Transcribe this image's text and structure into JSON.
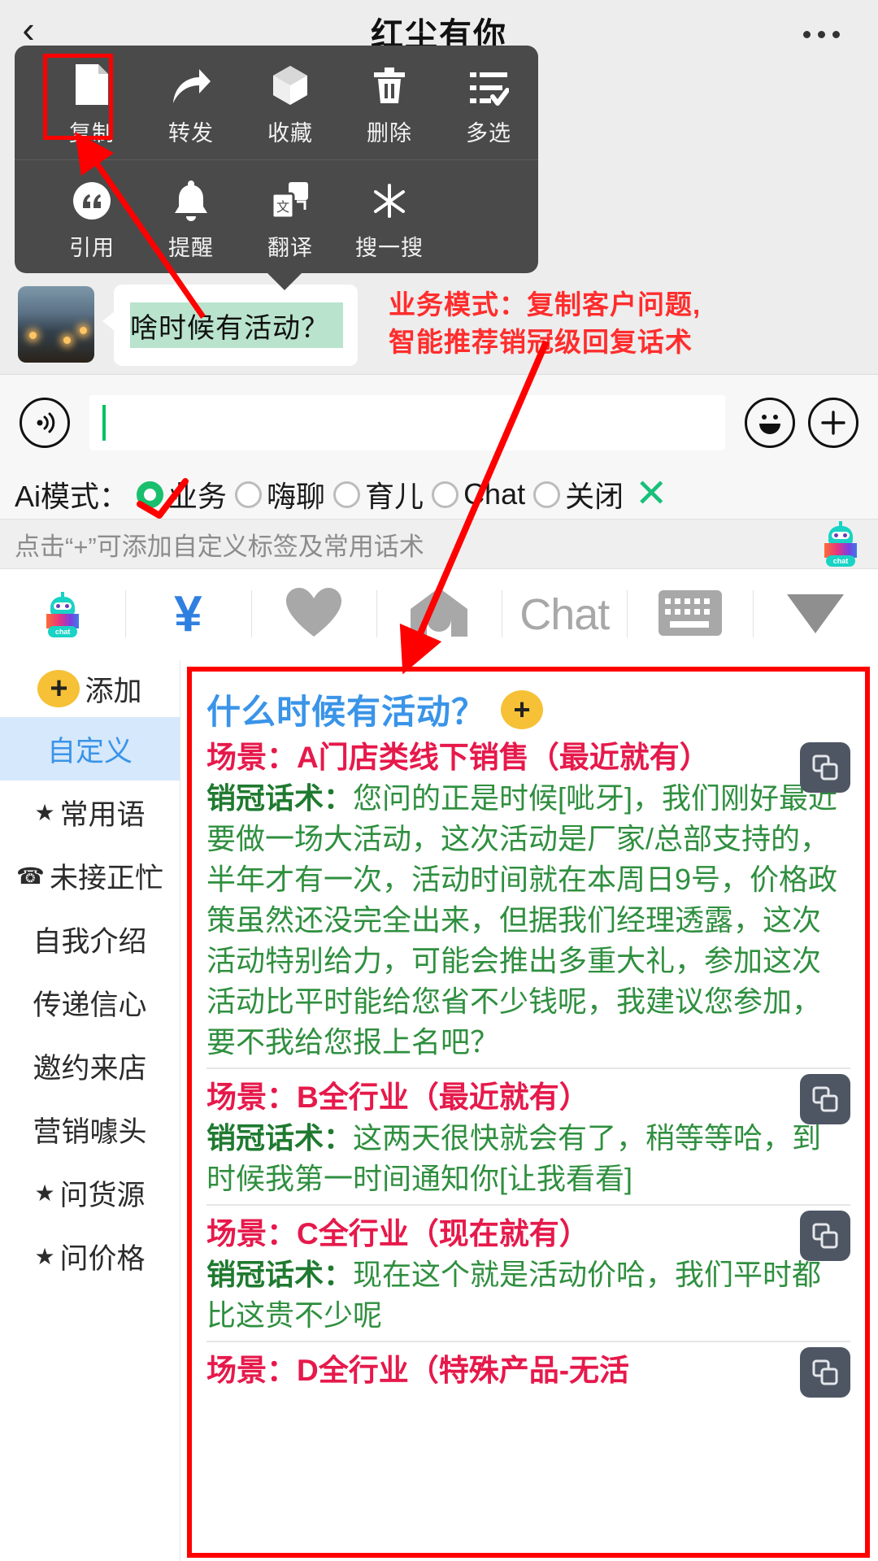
{
  "titlebar": {
    "back_icon": "chevron-left-icon",
    "title": "红尘有你",
    "more_icon": "more-dots-icon"
  },
  "context_menu": {
    "row1": [
      {
        "label": "复制",
        "icon": "copy-document-icon",
        "highlighted": true
      },
      {
        "label": "转发",
        "icon": "forward-arrow-icon",
        "highlighted": false
      },
      {
        "label": "收藏",
        "icon": "favorite-box-icon",
        "highlighted": false
      },
      {
        "label": "删除",
        "icon": "trash-icon",
        "highlighted": false
      },
      {
        "label": "多选",
        "icon": "multi-select-icon",
        "highlighted": false
      }
    ],
    "row2": [
      {
        "label": "引用",
        "icon": "quote-icon"
      },
      {
        "label": "提醒",
        "icon": "bell-icon"
      },
      {
        "label": "翻译",
        "icon": "translate-icon"
      },
      {
        "label": "搜一搜",
        "icon": "search-asterisk-icon"
      }
    ]
  },
  "message": {
    "avatar_name": "contact-avatar",
    "text": "啥时候有活动？"
  },
  "annotation": {
    "line1": "业务模式：复制客户问题,",
    "line2": "智能推荐销冠级回复话术",
    "color": "#ff2d2d"
  },
  "input_bar": {
    "voice_icon": "voice-wave-icon",
    "input_value": "",
    "input_placeholder": "",
    "emoji_icon": "smiley-icon",
    "plus_icon": "plus-circle-icon"
  },
  "ai_mode": {
    "label": "Ai模式：",
    "options": [
      {
        "label": "业务",
        "selected": true
      },
      {
        "label": "嗨聊",
        "selected": false
      },
      {
        "label": "育儿",
        "selected": false
      },
      {
        "label": "Chat",
        "selected": false
      },
      {
        "label": "关闭",
        "selected": false
      }
    ],
    "close_icon": "close-x-icon",
    "selected_color": "#1abf6d",
    "close_color": "#18c07a"
  },
  "hint": {
    "text": "点击“+”可添加自定义标签及常用话术",
    "robot_icon": "ai-chat-robot-icon",
    "robot_label": "chat"
  },
  "icon_toolbar": [
    {
      "icon": "ai-chat-robot-icon",
      "label": "chat"
    },
    {
      "icon": "yen-currency-icon",
      "label": "¥"
    },
    {
      "icon": "heart-icon",
      "label": ""
    },
    {
      "icon": "graduation-cap-icon",
      "label": ""
    },
    {
      "icon": "chat-text-icon",
      "label": "Chat"
    },
    {
      "icon": "keyboard-icon",
      "label": ""
    },
    {
      "icon": "chevron-down-triangle-icon",
      "label": ""
    }
  ],
  "sidebar": {
    "add_label": "添加",
    "add_icon": "plus-circle-yellow-icon",
    "items": [
      {
        "label": "自定义",
        "active": true,
        "star": false,
        "phone": false
      },
      {
        "label": "常用语",
        "active": false,
        "star": true,
        "phone": false
      },
      {
        "label": "未接正忙",
        "active": false,
        "star": false,
        "phone": true
      },
      {
        "label": "自我介绍",
        "active": false,
        "star": false,
        "phone": false
      },
      {
        "label": "传递信心",
        "active": false,
        "star": false,
        "phone": false
      },
      {
        "label": "邀约来店",
        "active": false,
        "star": false,
        "phone": false
      },
      {
        "label": "营销噱头",
        "active": false,
        "star": false,
        "phone": false
      },
      {
        "label": "问货源",
        "active": false,
        "star": true,
        "phone": false
      },
      {
        "label": "问价格",
        "active": false,
        "star": true,
        "phone": false
      }
    ]
  },
  "answer_panel": {
    "question": "什么时候有活动？",
    "add_icon": "plus-circle-yellow-icon",
    "copy_icon": "copy-squares-icon",
    "answer_prefix": "销冠话术：",
    "scenes": [
      {
        "title": "场景：A门店类线下销售（最近就有）",
        "answer": "您问的正是时候[呲牙]，我们刚好最近要做一场大活动，这次活动是厂家/总部支持的，半年才有一次，活动时间就在本周日9号，价格政策虽然还没完全出来，但据我们经理透露，这次活动特别给力，可能会推出多重大礼，参加这次活动比平时能给您省不少钱呢，我建议您参加，要不我给您报上名吧？"
      },
      {
        "title": "场景：B全行业（最近就有）",
        "answer": "这两天很快就会有了，稍等等哈，到时候我第一时间通知你[让我看看]"
      },
      {
        "title": "场景：C全行业（现在就有）",
        "answer": "现在这个就是活动价哈，我们平时都比这贵不少呢"
      },
      {
        "title": "场景：D全行业（特殊产品-无活",
        "answer": ""
      }
    ]
  },
  "colors": {
    "accent_blue": "#3a94e8",
    "scene_red": "#e6194b",
    "answer_green": "#2f8f3f",
    "annotation_red": "#ff2d2d",
    "highlight_border": "#ff0000",
    "yellow": "#f6c136"
  }
}
